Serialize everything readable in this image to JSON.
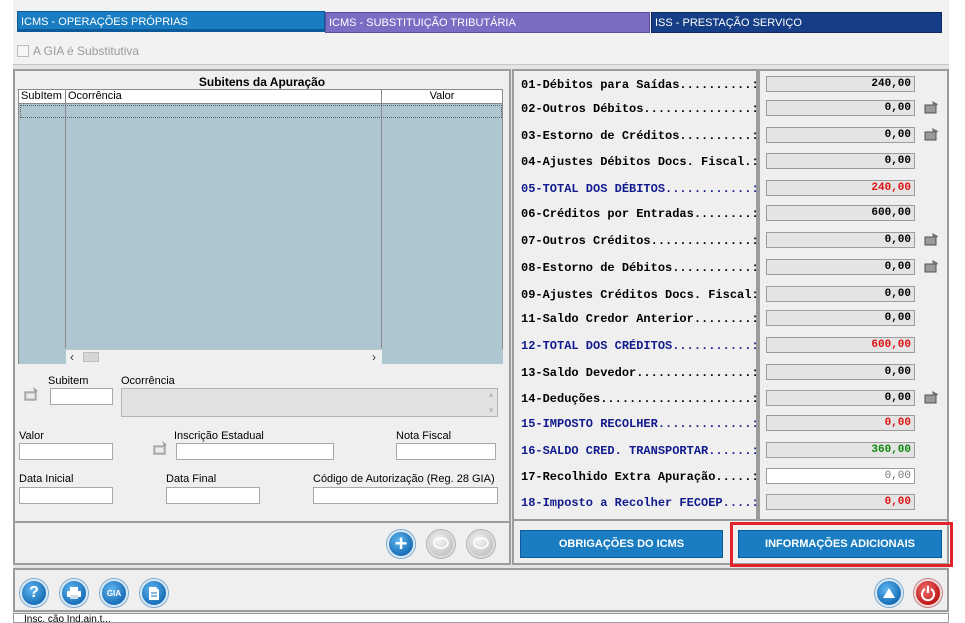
{
  "tabs": [
    {
      "label": "ICMS - OPERAÇÕES PRÓPRIAS"
    },
    {
      "label": "ICMS - SUBSTITUIÇÃO TRIBUTÁRIA"
    },
    {
      "label": "ISS - PRESTAÇÃO SERVIÇO"
    }
  ],
  "gia_substitutiva": {
    "label": "A GIA é Substitutiva",
    "checked": false
  },
  "subitens": {
    "title": "Subitens da Apuração",
    "columns": [
      "SubItem",
      "Ocorrência",
      "Valor"
    ]
  },
  "form": {
    "subitem_label": "Subitem",
    "ocorrencia_label": "Ocorrência",
    "valor_label": "Valor",
    "inscricao_label": "Inscrição Estadual",
    "nota_fiscal_label": "Nota Fiscal",
    "data_inicial_label": "Data Inicial",
    "data_final_label": "Data Final",
    "codigo_autorizacao_label": "Código de Autorização (Reg. 28 GIA)"
  },
  "apuracao": [
    {
      "label": "01-Débitos para Saídas..........:",
      "value": "240,00",
      "style": "normal",
      "action": false
    },
    {
      "label": "02-Outros Débitos...............:",
      "value": "0,00",
      "style": "normal",
      "action": true
    },
    {
      "label": "03-Estorno de Créditos..........:",
      "value": "0,00",
      "style": "normal",
      "action": true
    },
    {
      "label": "04-Ajustes Débitos Docs. Fiscal.:",
      "value": "0,00",
      "style": "normal",
      "action": false
    },
    {
      "label": "05-TOTAL DOS DÉBITOS............:",
      "value": "240,00",
      "style": "total-red",
      "action": false
    },
    {
      "label": "06-Créditos por Entradas........:",
      "value": "600,00",
      "style": "normal",
      "action": false
    },
    {
      "label": "07-Outros Créditos..............:",
      "value": "0,00",
      "style": "normal",
      "action": true
    },
    {
      "label": "08-Estorno de Débitos...........:",
      "value": "0,00",
      "style": "normal",
      "action": true
    },
    {
      "label": "09-Ajustes Créditos Docs. Fiscal:",
      "value": "0,00",
      "style": "normal",
      "action": false
    },
    {
      "label": "11-Saldo Credor Anterior........:",
      "value": "0,00",
      "style": "normal",
      "action": false
    },
    {
      "label": "12-TOTAL DOS CRÉDITOS...........:",
      "value": "600,00",
      "style": "total-red",
      "action": false
    },
    {
      "label": "13-Saldo Devedor................:",
      "value": "0,00",
      "style": "normal",
      "action": false
    },
    {
      "label": "14-Deduções.....................:",
      "value": "0,00",
      "style": "normal",
      "action": true
    },
    {
      "label": "15-IMPOSTO RECOLHER.............:",
      "value": "0,00",
      "style": "total-red",
      "action": false
    },
    {
      "label": "16-SALDO CRED. TRANSPORTAR......:",
      "value": "360,00",
      "style": "total-green",
      "action": false
    },
    {
      "label": "17-Recolhido Extra Apuração.....:",
      "value": "0,00",
      "style": "editable",
      "action": false
    },
    {
      "label": "18-Imposto a Recolher FECOEP....:",
      "value": "0,00",
      "style": "total-red",
      "action": false
    }
  ],
  "buttons": {
    "obrigacoes": "OBRIGAÇÕES DO ICMS",
    "informacoes": "INFORMAÇÕES ADICIONAIS",
    "gia": "GIA"
  },
  "status": {
    "text": "Insc. ção Ind.ain.t..."
  },
  "colors": {
    "tab_operacoes": "#1a7dc2",
    "tab_substituicao": "#7b6dc4",
    "tab_iss": "#163e86",
    "total_label": "#101a8c",
    "value_red": "#e01010",
    "value_green": "#0c8a0c",
    "highlight_frame": "#e2232a"
  }
}
